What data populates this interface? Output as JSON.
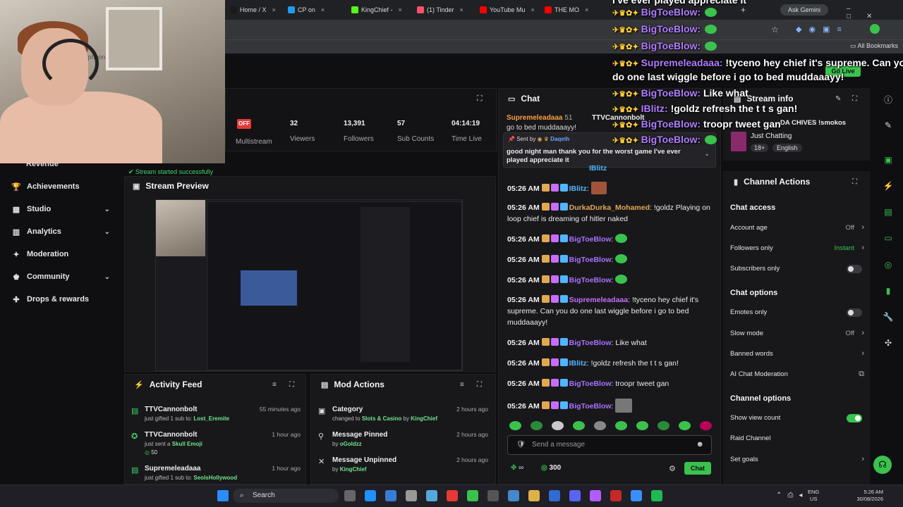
{
  "browser": {
    "tabs": [
      {
        "label": "Home / X",
        "color": "#1a1a1a"
      },
      {
        "label": "CP on",
        "color": "#1d9bf0"
      },
      {
        "label": "KingChief -",
        "color": "#53fc18"
      },
      {
        "label": "(1) Tinder",
        "color": "#fd5068"
      },
      {
        "label": "YouTube Mu",
        "color": "#ff0000"
      },
      {
        "label": "THE MO",
        "color": "#ff0000"
      }
    ],
    "ask_gemini": "Ask Gemini",
    "all_bookmarks": "All Bookmarks",
    "go_live": "Go Live"
  },
  "webcam": {
    "shelf_text": "Typhoon"
  },
  "stats": {
    "status": "OFF",
    "multistream": "Multistream",
    "viewers_value": "32",
    "viewers_label": "Viewers",
    "followers_value": "13,391",
    "followers_label": "Followers",
    "subs_value": "57",
    "subs_label": "Sub Counts",
    "time_value": "04:14:19",
    "time_label": "Time Live"
  },
  "sidebar": {
    "partial_item": "Revenue",
    "stream_started": "Stream started successfully",
    "items": [
      {
        "label": "Achievements",
        "chevron": false
      },
      {
        "label": "Studio",
        "chevron": true
      },
      {
        "label": "Analytics",
        "chevron": true
      },
      {
        "label": "Moderation",
        "chevron": false
      },
      {
        "label": "Community",
        "chevron": true
      },
      {
        "label": "Drops & rewards",
        "chevron": false
      }
    ]
  },
  "preview": {
    "title": "Stream Preview"
  },
  "activity": {
    "title": "Activity Feed",
    "items": [
      {
        "name": "TTVCannonbolt",
        "time": "55 minutes ago",
        "action": "just gifted 1 sub to:",
        "target": "Lost_Eremite"
      },
      {
        "name": "TTVCannonbolt",
        "time": "1 hour ago",
        "action": "just sent a",
        "target": "Skull Emoji",
        "amount": "50"
      },
      {
        "name": "Supremeleadaaa",
        "time": "1 hour ago",
        "action": "just gifted 1 sub to:",
        "target": "SeolsHollywood"
      }
    ]
  },
  "mod": {
    "title": "Mod Actions",
    "items": [
      {
        "name": "Category",
        "time": "2 hours ago",
        "pre": "changed to",
        "mid": "Slots & Casino",
        "by": "by",
        "who": "KingChief"
      },
      {
        "name": "Message Pinned",
        "time": "2 hours ago",
        "pre": "",
        "mid": "",
        "by": "by",
        "who": "oGoldzz"
      },
      {
        "name": "Message Unpinned",
        "time": "2 hours ago",
        "pre": "",
        "mid": "",
        "by": "by",
        "who": "KingChief"
      }
    ]
  },
  "chat": {
    "title": "Chat",
    "header_user": "Supremeleadaaa",
    "header_count": "51",
    "header_user2": "TTVCannonbolt",
    "cut_text": "go to bed muddaaayy!",
    "pinned_sent_by": "Sent by",
    "pinned_user": "Daqeth",
    "pinned_text": "good night man thank you for the worst game I've ever played appreciate it",
    "partial_user": "IBlitz",
    "messages": [
      {
        "time": "05:26 AM",
        "user": "IBlitz",
        "color": "#4fb6ff",
        "text": "",
        "emote": "face"
      },
      {
        "time": "05:26 AM",
        "user": "DurkaDurka_Mohamed",
        "color": "#e0a94f",
        "text": "!goldz Playing on loop chief is dreaming of hitler naked",
        "emote": ""
      },
      {
        "time": "05:26 AM",
        "user": "BigToeBlow",
        "color": "#a970ff",
        "text": "",
        "emote": "green"
      },
      {
        "time": "05:26 AM",
        "user": "BigToeBlow",
        "color": "#a970ff",
        "text": "",
        "emote": "green"
      },
      {
        "time": "05:26 AM",
        "user": "BigToeBlow",
        "color": "#a970ff",
        "text": "",
        "emote": "green"
      },
      {
        "time": "05:26 AM",
        "user": "Supremeleadaaa",
        "color": "#c86cff",
        "text": "!tyceno hey chief it's supreme. Can you do one last wiggle before i go to bed muddaaayy!",
        "emote": ""
      },
      {
        "time": "05:26 AM",
        "user": "BigToeBlow",
        "color": "#a970ff",
        "text": "Like what",
        "emote": ""
      },
      {
        "time": "05:26 AM",
        "user": "IBlitz",
        "color": "#4fb6ff",
        "text": "!goldz refresh the t t s gan!",
        "emote": ""
      },
      {
        "time": "05:26 AM",
        "user": "BigToeBlow",
        "color": "#a970ff",
        "text": "troopr tweet gan",
        "emote": ""
      },
      {
        "time": "05:26 AM",
        "user": "BigToeBlow",
        "color": "#a970ff",
        "text": "",
        "emote": "face2"
      }
    ],
    "input_placeholder": "Send a message",
    "points": "300",
    "chat_button": "Chat"
  },
  "stream_info": {
    "title": "Stream info",
    "category": "Just Chatting",
    "tag1": "18+",
    "tag2": "English",
    "stream_title": "DA CHIVES !smokos"
  },
  "channel_actions": {
    "title": "Channel Actions",
    "chat_access": "Chat access",
    "account_age": "Account age",
    "account_age_val": "Off",
    "followers_only": "Followers only",
    "followers_only_val": "Instant",
    "subscribers_only": "Subscribers only",
    "chat_options": "Chat options",
    "emotes_only": "Emotes only",
    "slow_mode": "Slow mode",
    "slow_mode_val": "Off",
    "banned_words": "Banned words",
    "ai_moderation": "AI Chat Moderation",
    "channel_options": "Channel options",
    "show_view_count": "Show view count",
    "raid_channel": "Raid Channel",
    "set_goals": "Set goals"
  },
  "overlay": {
    "top": "I've ever played appreciate it",
    "lines": [
      {
        "user": "BigToeBlow:",
        "text": ""
      },
      {
        "user": "BigToeBlow:",
        "text": ""
      },
      {
        "user": "BigToeBlow:",
        "text": ""
      },
      {
        "user": "Supremeleadaaa:",
        "text": " !tyceno hey chief it's supreme. Can you"
      },
      {
        "user": "",
        "text": "do one last wiggle before i go to bed muddaaayy!"
      },
      {
        "user": "BigToeBlow:",
        "text": " Like what"
      },
      {
        "user": "IBlitz:",
        "text": " !goldz refresh the t t s gan!"
      },
      {
        "user": "BigToeBlow:",
        "text": " troopr tweet gan"
      },
      {
        "user": "BigToeBlow:",
        "text": ""
      }
    ]
  },
  "taskbar": {
    "search": "Search",
    "lang1": "ENG",
    "lang2": "US",
    "time": "5:26 AM",
    "date": "30/08/2026"
  }
}
